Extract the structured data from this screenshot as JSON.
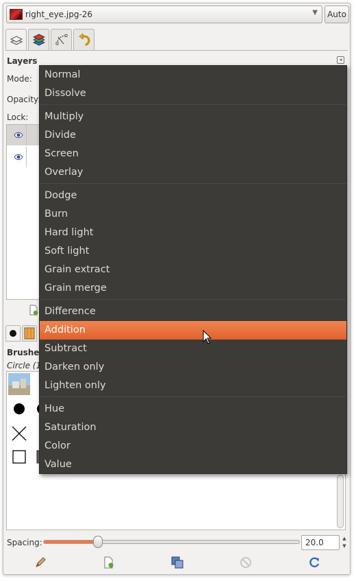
{
  "header": {
    "image_name": "right_eye.jpg-26",
    "auto_label": "Auto"
  },
  "dock_tabs": [
    {
      "icon": "layers-icon"
    },
    {
      "icon": "channels-icon"
    },
    {
      "icon": "paths-icon"
    },
    {
      "icon": "undo-history-icon"
    }
  ],
  "layers_panel": {
    "title": "Layers",
    "mode_label": "Mode:",
    "opacity_label": "Opacity:",
    "lock_label": "Lock:"
  },
  "mode_menu": {
    "groups": [
      [
        "Normal",
        "Dissolve"
      ],
      [
        "Multiply",
        "Divide",
        "Screen",
        "Overlay"
      ],
      [
        "Dodge",
        "Burn",
        "Hard light",
        "Soft light",
        "Grain extract",
        "Grain merge"
      ],
      [
        "Difference",
        "Addition",
        "Subtract",
        "Darken only",
        "Lighten only"
      ],
      [
        "Hue",
        "Saturation",
        "Color",
        "Value"
      ]
    ],
    "highlighted": "Addition",
    "highlight_color": "#e9733f"
  },
  "brushes_panel": {
    "title": "Brushes",
    "brush_name": "Circle (1"
  },
  "spacing": {
    "label": "Spacing:",
    "value": "20.0",
    "fraction": 0.2
  },
  "bottom_actions": [
    {
      "icon": "edit-brush-icon"
    },
    {
      "icon": "new-brush-icon"
    },
    {
      "icon": "duplicate-brush-icon"
    },
    {
      "icon": "delete-brush-icon"
    },
    {
      "icon": "refresh-brushes-icon"
    }
  ]
}
